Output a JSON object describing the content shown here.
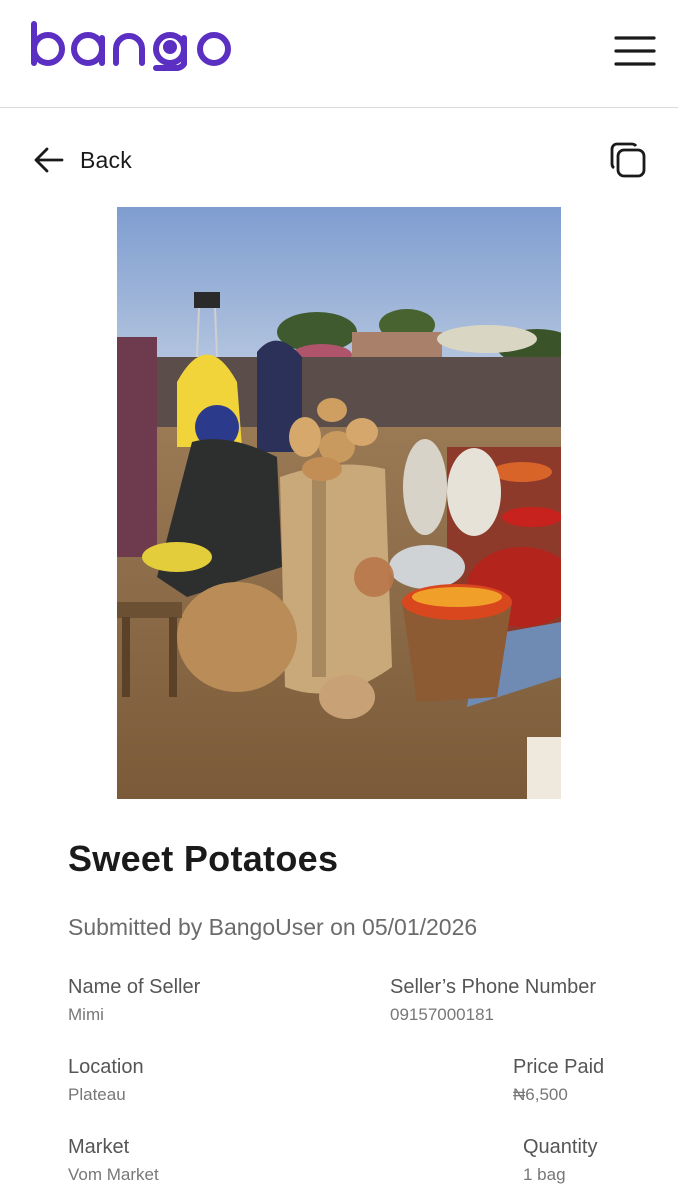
{
  "app": {
    "brand": "bango",
    "brand_color": "#5a2fc2"
  },
  "toolbar": {
    "back_label": "Back",
    "copy_icon": "copy-icon"
  },
  "product": {
    "title": "Sweet Potatoes",
    "submitted_text": "Submitted by BangoUser on 05/01/2026",
    "image_description_icon": "market-photo"
  },
  "fields": {
    "seller_name": {
      "label": "Name of Seller",
      "value": "Mimi"
    },
    "seller_phone": {
      "label": "Seller’s Phone Number",
      "value": "09157000181"
    },
    "location": {
      "label": "Location",
      "value": "Plateau"
    },
    "price_paid": {
      "label": "Price Paid",
      "value": "₦6,500"
    },
    "market": {
      "label": "Market",
      "value": "Vom Market"
    },
    "quantity": {
      "label": "Quantity",
      "value": "1 bag"
    }
  },
  "colors": {
    "text_dark": "#1a1a1a",
    "text_muted": "#6b6b6b",
    "divider": "#d9d9d9"
  }
}
